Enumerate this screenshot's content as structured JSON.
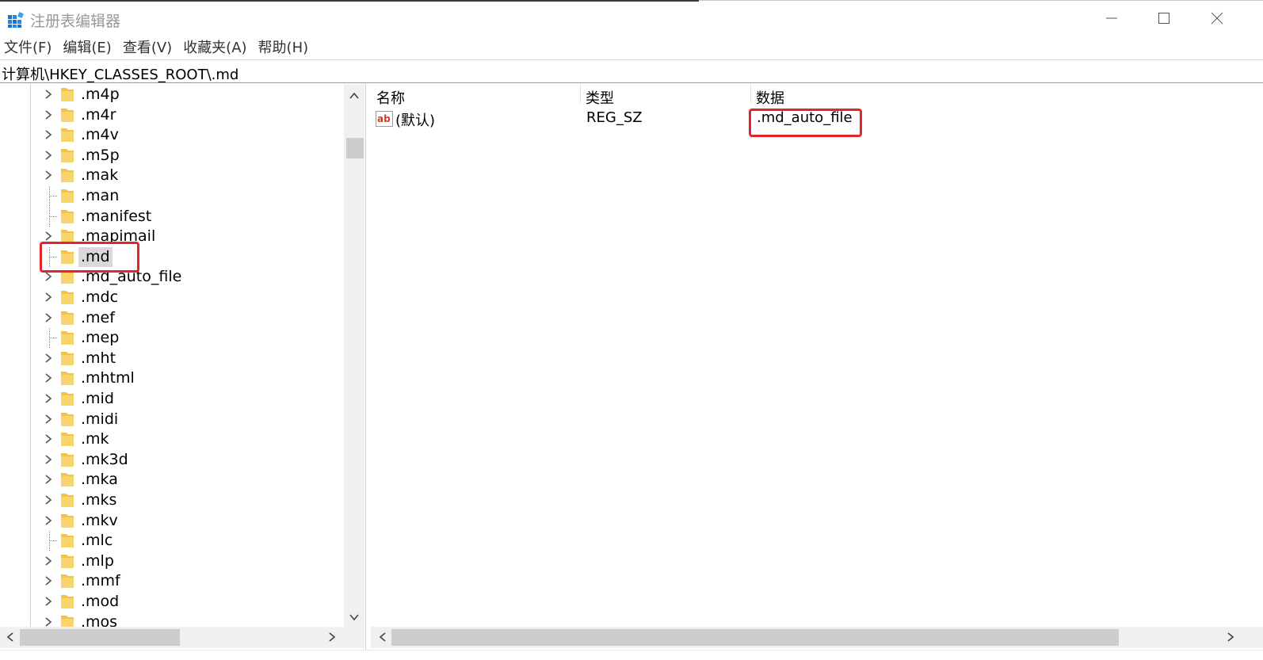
{
  "window": {
    "title": "注册表编辑器",
    "app_icon": "registry-editor-icon",
    "controls": [
      "minimize-icon",
      "maximize-icon",
      "close-icon"
    ]
  },
  "menu": [
    {
      "label": "文件(F)"
    },
    {
      "label": "编辑(E)"
    },
    {
      "label": "查看(V)"
    },
    {
      "label": "收藏夹(A)"
    },
    {
      "label": "帮助(H)"
    }
  ],
  "address": "计算机\\HKEY_CLASSES_ROOT\\.md",
  "tree": {
    "items": [
      {
        "label": ".m4p",
        "expandable": true
      },
      {
        "label": ".m4r",
        "expandable": true
      },
      {
        "label": ".m4v",
        "expandable": true
      },
      {
        "label": ".m5p",
        "expandable": true
      },
      {
        "label": ".mak",
        "expandable": true
      },
      {
        "label": ".man",
        "expandable": false
      },
      {
        "label": ".manifest",
        "expandable": false
      },
      {
        "label": ".mapimail",
        "expandable": true
      },
      {
        "label": ".md",
        "expandable": false,
        "selected": true
      },
      {
        "label": ".md_auto_file",
        "expandable": true
      },
      {
        "label": ".mdc",
        "expandable": true
      },
      {
        "label": ".mef",
        "expandable": true
      },
      {
        "label": ".mep",
        "expandable": false
      },
      {
        "label": ".mht",
        "expandable": true
      },
      {
        "label": ".mhtml",
        "expandable": true
      },
      {
        "label": ".mid",
        "expandable": true
      },
      {
        "label": ".midi",
        "expandable": true
      },
      {
        "label": ".mk",
        "expandable": true
      },
      {
        "label": ".mk3d",
        "expandable": true
      },
      {
        "label": ".mka",
        "expandable": true
      },
      {
        "label": ".mks",
        "expandable": true
      },
      {
        "label": ".mkv",
        "expandable": true
      },
      {
        "label": ".mlc",
        "expandable": false
      },
      {
        "label": ".mlp",
        "expandable": true
      },
      {
        "label": ".mmf",
        "expandable": true
      },
      {
        "label": ".mod",
        "expandable": true
      },
      {
        "label": ".mos",
        "expandable": true
      }
    ]
  },
  "list": {
    "columns": {
      "name": "名称",
      "type": "类型",
      "data": "数据"
    },
    "rows": [
      {
        "icon": "string-value-icon",
        "name": "(默认)",
        "type": "REG_SZ",
        "data": ".md_auto_file"
      }
    ]
  },
  "colors": {
    "highlight": "#e3262b",
    "folder": "#f3c544",
    "selection": "#d9d9d9"
  }
}
